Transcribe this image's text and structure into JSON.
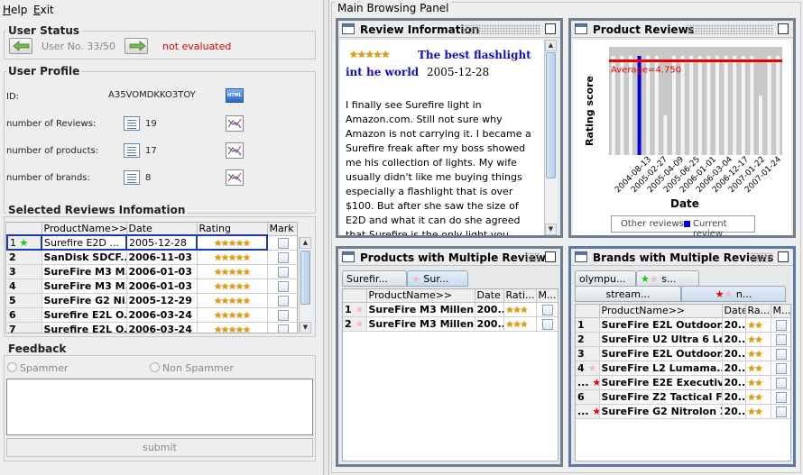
{
  "menu": {
    "help": "Help",
    "exit": "Exit"
  },
  "user_status": {
    "title": "User Status",
    "user_no": "User No. 33/50",
    "evaluation": "not evaluated"
  },
  "user_profile": {
    "title": "User Profile",
    "id_label": "ID:",
    "id_value": "A35VOMDKKO3TOY",
    "rows": [
      {
        "label": "number of Reviews:",
        "value": "19"
      },
      {
        "label": "number of products:",
        "value": "17"
      },
      {
        "label": "number of brands:",
        "value": "8"
      }
    ]
  },
  "selected_reviews": {
    "title": "Selected Reviews Infomation",
    "columns": [
      "",
      "ProductName>>",
      "Date",
      "Rating",
      "Mark"
    ],
    "rows": [
      {
        "n": "1",
        "name": "Surefire E2D ...",
        "date": "2005-12-28",
        "stars": "★★★★★"
      },
      {
        "n": "2",
        "name": "SanDisk SDCF...",
        "date": "2006-11-03",
        "stars": "★★★★★"
      },
      {
        "n": "3",
        "name": "SureFire M3 M...",
        "date": "2006-01-03",
        "stars": "★★★★★"
      },
      {
        "n": "4",
        "name": "SureFire M3 M...",
        "date": "2006-01-03",
        "stars": "★★★★★"
      },
      {
        "n": "5",
        "name": "SureFire G2 Ni...",
        "date": "2005-12-29",
        "stars": "★★★★★"
      },
      {
        "n": "6",
        "name": "Surefire E2L O...",
        "date": "2006-03-24",
        "stars": "★★★★★"
      },
      {
        "n": "7",
        "name": "Surefire E2L O...",
        "date": "2006-03-24",
        "stars": "★★★★★"
      }
    ]
  },
  "feedback": {
    "title": "Feedback",
    "spammer": "Spammer",
    "non_spammer": "Non Spammer",
    "submit": "submit"
  },
  "main_panel": {
    "title": "Main Browsing Panel"
  },
  "review_info": {
    "title": "Review Information",
    "stars": "★★★★★",
    "headline_1": "The best flashlight",
    "headline_2": "int he world",
    "date": "2005-12-28",
    "body": "I finally see Surefire light in Amazon.com. Still not sure why Amazon is not carrying it. I became a Surefire freak after my boss showed me his collection of lights. My wife usually didn't like me buying things especially a flashlight that is over $100. But after she saw the size of E2D and what it can do she agreed that Surefire is the only light you should own and a"
  },
  "product_reviews": {
    "title": "Product Reviews",
    "legend_other": "Other reviews",
    "legend_current": "Current review"
  },
  "chart_data": {
    "type": "bar",
    "ylabel": "Rating score",
    "xlabel": "Date",
    "average_label": "Average=4.750",
    "average": 4.75,
    "ylim": [
      0,
      5
    ],
    "tick_labels": [
      "2004-08-13",
      "2005-02-27",
      "2005-04-09",
      "2005-06-25",
      "2006-01-01",
      "2006-03-04",
      "2006-12-17",
      "2007-01-22",
      "2007-01-24"
    ],
    "values": [
      5,
      5,
      5,
      5,
      5,
      5,
      2,
      5,
      5,
      5,
      5,
      5,
      5,
      5,
      5,
      5,
      5,
      3,
      5,
      5
    ],
    "current_index": 3,
    "colors": {
      "bar": "#f4f4f4",
      "current": "#0000dd",
      "average": "#ee0000",
      "plot_bg": "#c8c8c8"
    }
  },
  "products_multi": {
    "title": "Products with Multiple Reviews",
    "tabs": [
      "Surefir...",
      "Sur..."
    ],
    "columns": [
      "",
      "ProductName>>",
      "Date",
      "Rati...",
      "M..."
    ],
    "rows": [
      {
        "n": "1",
        "name": "SureFire M3 Milleni...",
        "date": "200...",
        "stars": "★★★"
      },
      {
        "n": "2",
        "name": "SureFire M3 Milleni...",
        "date": "200...",
        "stars": "★★★"
      }
    ]
  },
  "brands_multi": {
    "title": "Brands with Multiple Reviews",
    "tabs": [
      "olympu...",
      "s...",
      "stream...",
      "n..."
    ],
    "columns": [
      "",
      "ProductName>>",
      "Date",
      "Ra...",
      "M..."
    ],
    "rows": [
      {
        "n": "1",
        "name": "SureFire E2L Outdoor...",
        "date": "20...",
        "stars": "★★",
        "mark": ""
      },
      {
        "n": "2",
        "name": "SureFire U2 Ultra 6 Le...",
        "date": "20...",
        "stars": "★★",
        "mark": ""
      },
      {
        "n": "3",
        "name": "SureFire E2L Outdoor...",
        "date": "20...",
        "stars": "★★",
        "mark": ""
      },
      {
        "n": "4",
        "name": "SureFire L2 Lumama...",
        "date": "20...",
        "stars": "★★",
        "mark": "pink"
      },
      {
        "n": "...",
        "name": "SureFire E2E Executiv...",
        "date": "20...",
        "stars": "★★",
        "mark": "red"
      },
      {
        "n": "6",
        "name": "SureFire Z2 Tactical F...",
        "date": "20...",
        "stars": "★★",
        "mark": ""
      },
      {
        "n": "...",
        "name": "SureFire G2 Nitrolon X...",
        "date": "20...",
        "stars": "★★",
        "mark": "red"
      }
    ]
  }
}
